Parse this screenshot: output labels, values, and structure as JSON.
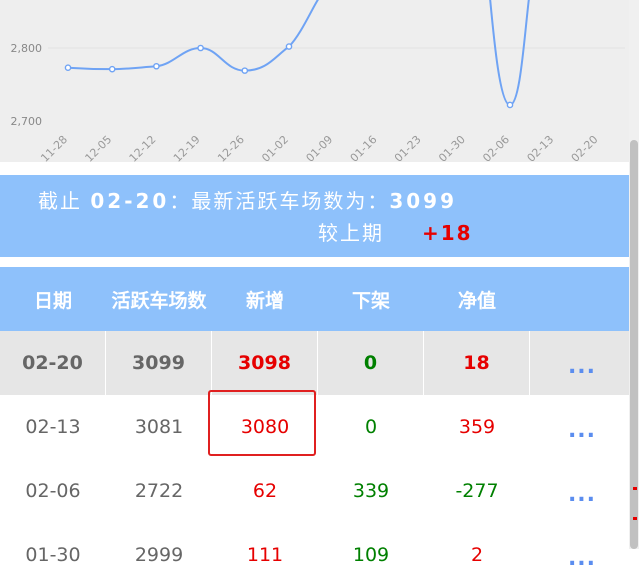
{
  "chart": {
    "y_ticks": [
      "2,800",
      "2,700"
    ],
    "x_ticks": [
      "11-28",
      "12-05",
      "12-12",
      "12-19",
      "12-26",
      "01-02",
      "01-09",
      "01-16",
      "01-23",
      "01-30",
      "02-06",
      "02-13",
      "02-20"
    ],
    "series_color": "#6fa3f4"
  },
  "chart_data": {
    "type": "line",
    "x": [
      "11-28",
      "12-05",
      "12-12",
      "12-19",
      "12-26",
      "01-02",
      "01-09",
      "01-16",
      "01-23",
      "01-30",
      "02-06",
      "02-13",
      "02-20"
    ],
    "visible_points": [
      {
        "x": "11-28",
        "y": 2773
      },
      {
        "x": "12-05",
        "y": 2771
      },
      {
        "x": "12-12",
        "y": 2775
      },
      {
        "x": "12-19",
        "y": 2800
      },
      {
        "x": "12-26",
        "y": 2769
      },
      {
        "x": "01-02",
        "y": 2802
      },
      {
        "x": "02-06",
        "y": 2722
      }
    ],
    "ylabel_ticks": [
      2700,
      2800
    ]
  },
  "summary": {
    "prefix": "截止",
    "date": "02-20",
    "mid": "：最新活跃车场数为：",
    "count": "3099",
    "compare_label": "较上期",
    "delta": "+18"
  },
  "table": {
    "headers": [
      "日期",
      "活跃车场数",
      "新增",
      "下架",
      "净值"
    ],
    "more_label": "...",
    "rows": [
      {
        "date": "02-20",
        "active": "3099",
        "added": "3098",
        "removed": "0",
        "net": "18"
      },
      {
        "date": "02-13",
        "active": "3081",
        "added": "3080",
        "removed": "0",
        "net": "359"
      },
      {
        "date": "02-06",
        "active": "2722",
        "added": "62",
        "removed": "339",
        "net": "-277"
      },
      {
        "date": "01-30",
        "active": "2999",
        "added": "111",
        "removed": "109",
        "net": "2"
      }
    ]
  },
  "colors": {
    "header_bg": "#8ec1fb",
    "positive": "#e60000",
    "negative": "#008000",
    "more": "#5b8def"
  }
}
